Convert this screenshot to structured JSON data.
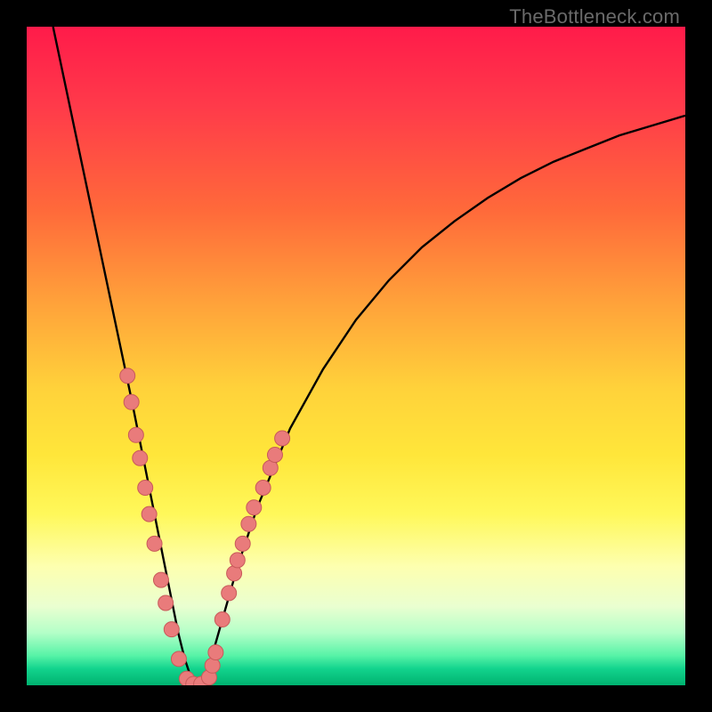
{
  "watermark": "TheBottleneck.com",
  "chart_data": {
    "type": "line",
    "title": "",
    "xlabel": "",
    "ylabel": "",
    "xlim": [
      0,
      100
    ],
    "ylim": [
      0,
      100
    ],
    "series": [
      {
        "name": "curve",
        "x": [
          4,
          6,
          8,
          10,
          12,
          14,
          16,
          17,
          18,
          19,
          20,
          21,
          22,
          23,
          24,
          25,
          26,
          27,
          28,
          30,
          32,
          35,
          40,
          45,
          50,
          55,
          60,
          65,
          70,
          75,
          80,
          85,
          90,
          95,
          100
        ],
        "y": [
          100,
          90.5,
          81,
          71.5,
          62,
          52.5,
          43,
          38,
          33,
          28,
          23,
          18,
          13,
          8,
          4,
          1,
          0,
          1,
          4,
          11,
          18,
          27,
          39,
          48,
          55.5,
          61.5,
          66.5,
          70.5,
          74,
          77,
          79.5,
          81.5,
          83.5,
          85,
          86.5
        ]
      }
    ],
    "markers": [
      {
        "x": 15.3,
        "y": 47
      },
      {
        "x": 15.9,
        "y": 43
      },
      {
        "x": 16.6,
        "y": 38
      },
      {
        "x": 17.2,
        "y": 34.5
      },
      {
        "x": 18.0,
        "y": 30
      },
      {
        "x": 18.6,
        "y": 26
      },
      {
        "x": 19.4,
        "y": 21.5
      },
      {
        "x": 20.4,
        "y": 16
      },
      {
        "x": 21.1,
        "y": 12.5
      },
      {
        "x": 22.0,
        "y": 8.5
      },
      {
        "x": 23.1,
        "y": 4
      },
      {
        "x": 24.3,
        "y": 1
      },
      {
        "x": 25.3,
        "y": 0.2
      },
      {
        "x": 26.5,
        "y": 0.2
      },
      {
        "x": 27.7,
        "y": 1.2
      },
      {
        "x": 28.2,
        "y": 3
      },
      {
        "x": 28.7,
        "y": 5
      },
      {
        "x": 29.7,
        "y": 10
      },
      {
        "x": 30.7,
        "y": 14
      },
      {
        "x": 31.5,
        "y": 17
      },
      {
        "x": 32.0,
        "y": 19
      },
      {
        "x": 32.8,
        "y": 21.5
      },
      {
        "x": 33.7,
        "y": 24.5
      },
      {
        "x": 34.5,
        "y": 27
      },
      {
        "x": 35.9,
        "y": 30
      },
      {
        "x": 37.0,
        "y": 33
      },
      {
        "x": 37.7,
        "y": 35
      },
      {
        "x": 38.8,
        "y": 37.5
      }
    ],
    "colors": {
      "curve": "#000000",
      "marker_fill": "#e97b7b",
      "marker_stroke": "#c85a5a"
    }
  }
}
